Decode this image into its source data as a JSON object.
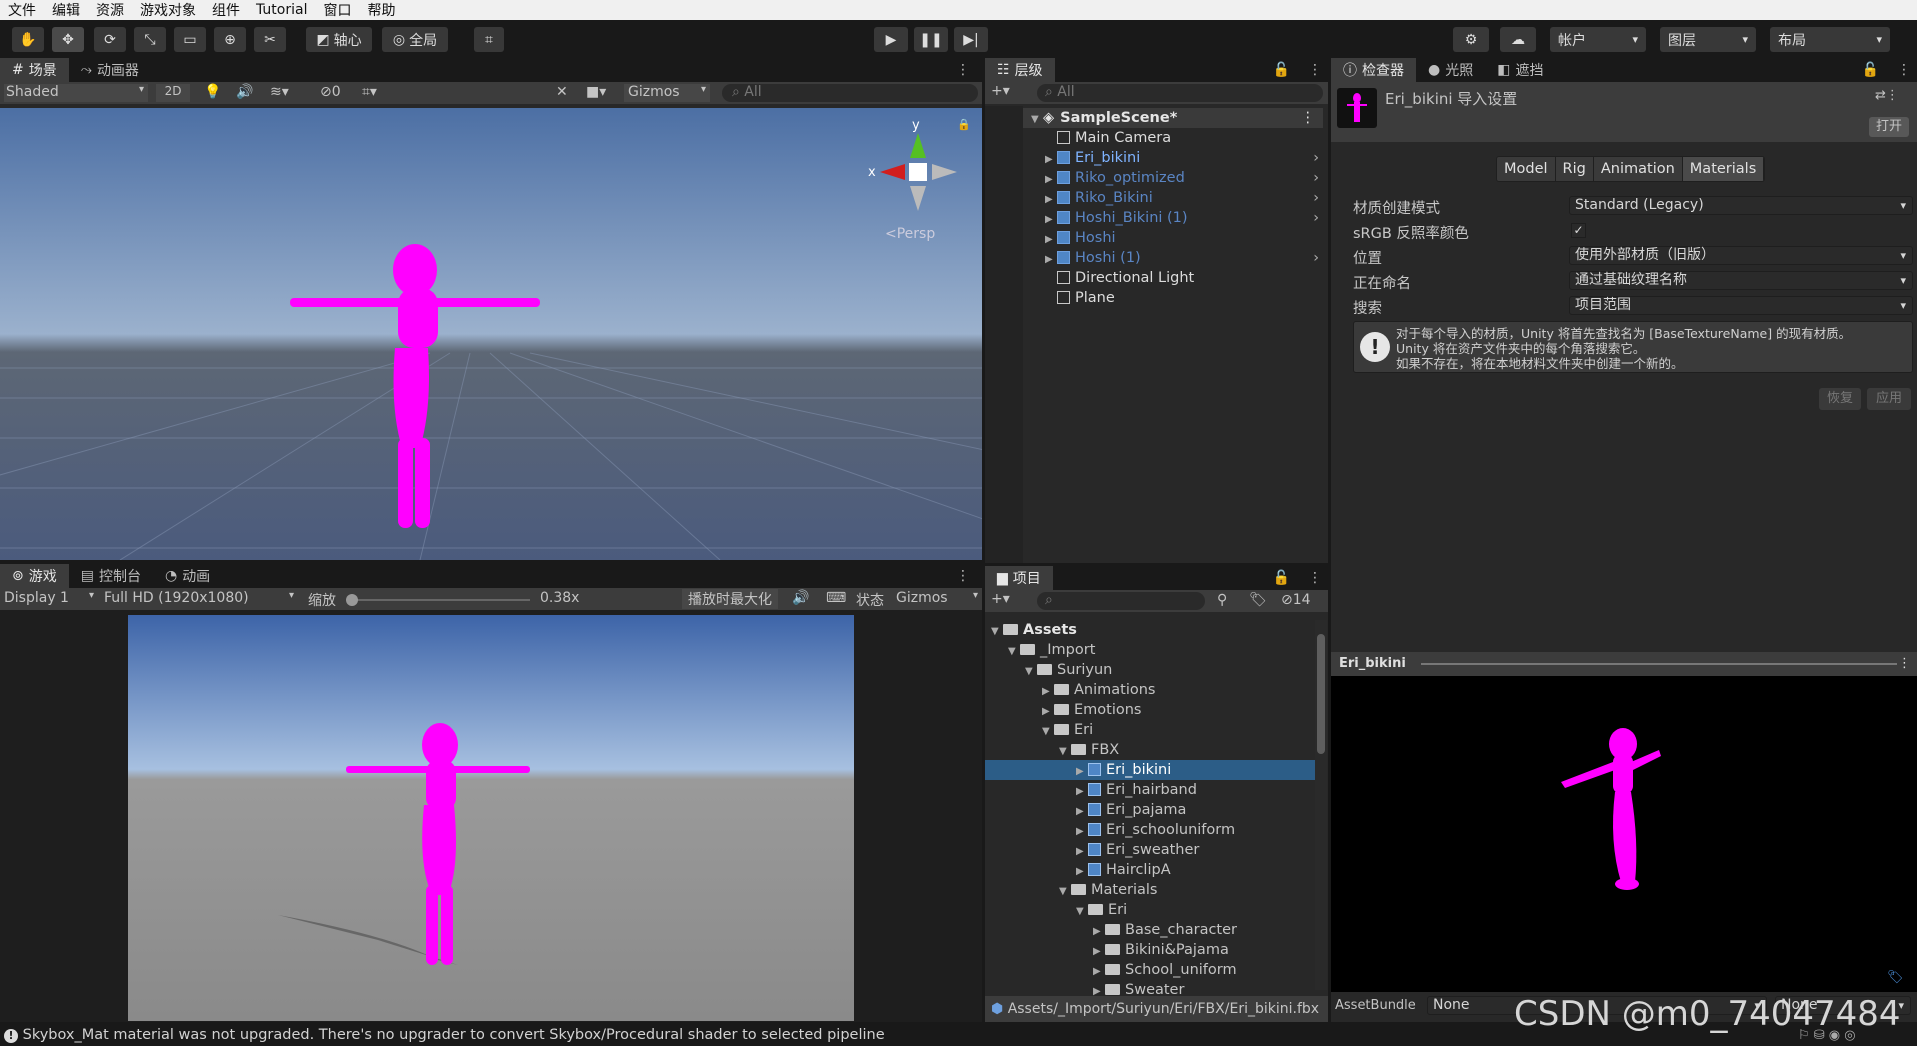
{
  "menu": [
    "文件",
    "编辑",
    "资源",
    "游戏对象",
    "组件",
    "Tutorial",
    "窗口",
    "帮助"
  ],
  "toolbar": {
    "pivot": "轴心",
    "global": "全局",
    "account": "帐户",
    "layers": "图层",
    "layout": "布局"
  },
  "scene": {
    "tab_scene": "场景",
    "tab_animator": "动画器",
    "shading": "Shaded",
    "mode2d": "2D",
    "hidden_count": "0",
    "gizmos": "Gizmos",
    "search_placeholder": "All",
    "persp": "<Persp",
    "axis_x": "x",
    "axis_y": "y"
  },
  "game": {
    "tab_game": "游戏",
    "tab_console": "控制台",
    "tab_animation": "动画",
    "display": "Display 1",
    "resolution": "Full HD (1920x1080)",
    "scale_label": "缩放",
    "scale_value": "0.38x",
    "maximize": "播放时最大化",
    "stats": "状态",
    "gizmos": "Gizmos",
    "scale_fraction": 0.0
  },
  "hierarchy": {
    "tab": "层级",
    "search_placeholder": "All",
    "scene": "SampleScene*",
    "items": [
      {
        "label": "Main Camera",
        "blue": false,
        "expand": false,
        "arrow_right": false
      },
      {
        "label": "Eri_bikini",
        "blue": true,
        "expand": true,
        "arrow_right": true,
        "bright": true
      },
      {
        "label": "Riko_optimized",
        "blue": true,
        "expand": true,
        "arrow_right": true
      },
      {
        "label": "Riko_Bikini",
        "blue": true,
        "expand": true,
        "arrow_right": true
      },
      {
        "label": "Hoshi_Bikini (1)",
        "blue": true,
        "expand": true,
        "arrow_right": true
      },
      {
        "label": "Hoshi",
        "blue": true,
        "expand": true,
        "arrow_right": false
      },
      {
        "label": "Hoshi (1)",
        "blue": true,
        "expand": true,
        "arrow_right": true
      },
      {
        "label": "Directional Light",
        "blue": false,
        "expand": false,
        "arrow_right": false
      },
      {
        "label": "Plane",
        "blue": false,
        "expand": false,
        "arrow_right": false
      }
    ]
  },
  "project": {
    "tab": "项目",
    "hidden_count": "14",
    "path": "Assets/_Import/Suriyun/Eri/FBX/Eri_bikini.fbx",
    "items": [
      {
        "label": "Assets",
        "depth": 0,
        "type": "folder",
        "open": true,
        "bold": true
      },
      {
        "label": "_Import",
        "depth": 1,
        "type": "folder",
        "open": true
      },
      {
        "label": "Suriyun",
        "depth": 2,
        "type": "folder",
        "open": true
      },
      {
        "label": "Animations",
        "depth": 3,
        "type": "folder",
        "open": false
      },
      {
        "label": "Emotions",
        "depth": 3,
        "type": "folder",
        "open": false
      },
      {
        "label": "Eri",
        "depth": 3,
        "type": "folder",
        "open": true
      },
      {
        "label": "FBX",
        "depth": 4,
        "type": "folder",
        "open": true
      },
      {
        "label": "Eri_bikini",
        "depth": 5,
        "type": "model",
        "open": false,
        "selected": true
      },
      {
        "label": "Eri_hairband",
        "depth": 5,
        "type": "model",
        "open": false
      },
      {
        "label": "Eri_pajama",
        "depth": 5,
        "type": "model",
        "open": false
      },
      {
        "label": "Eri_schooluniform",
        "depth": 5,
        "type": "model",
        "open": false
      },
      {
        "label": "Eri_sweather",
        "depth": 5,
        "type": "model",
        "open": false
      },
      {
        "label": "HairclipA",
        "depth": 5,
        "type": "model",
        "open": false
      },
      {
        "label": "Materials",
        "depth": 4,
        "type": "folder",
        "open": true
      },
      {
        "label": "Eri",
        "depth": 5,
        "type": "folder",
        "open": true
      },
      {
        "label": "Base_character",
        "depth": 6,
        "type": "folder",
        "open": false
      },
      {
        "label": "Bikini&Pajama",
        "depth": 6,
        "type": "folder",
        "open": false
      },
      {
        "label": "School_uniform",
        "depth": 6,
        "type": "folder",
        "open": false
      },
      {
        "label": "Sweater",
        "depth": 6,
        "type": "folder",
        "open": false
      }
    ]
  },
  "inspector": {
    "tab_inspector": "检查器",
    "tab_lighting": "光照",
    "tab_occlusion": "遮挡",
    "title": "Eri_bikini 导入设置",
    "open": "打开",
    "subtabs": [
      "Model",
      "Rig",
      "Animation",
      "Materials"
    ],
    "fields": [
      {
        "label": "材质创建模式",
        "value": "Standard (Legacy)",
        "type": "dropdown"
      },
      {
        "label": "sRGB 反照率颜色",
        "value": "✓",
        "type": "checkbox"
      },
      {
        "label": "位置",
        "value": "使用外部材质（旧版）",
        "type": "dropdown"
      },
      {
        "label": "正在命名",
        "value": "通过基础纹理名称",
        "type": "dropdown"
      },
      {
        "label": "搜索",
        "value": "项目范围",
        "type": "dropdown"
      }
    ],
    "info": [
      "对于每个导入的材质，Unity 将首先查找名为 [BaseTextureName] 的现有材质。",
      "Unity 将在资产文件夹中的每个角落搜索它。",
      "如果不存在，将在本地材料文件夹中创建一个新的。"
    ],
    "revert": "恢复",
    "apply": "应用"
  },
  "preview": {
    "title": "Eri_bikini",
    "assetbundle_label": "AssetBundle",
    "assetbundle_value": "None",
    "variant_value": "None"
  },
  "status": {
    "message": "Skybox_Mat material was not upgraded. There's no upgrader to convert Skybox/Procedural shader to selected pipeline"
  },
  "watermark": "CSDN @m0_74047484",
  "colors": {
    "accent_select": "#2c5d87",
    "magenta": "#ff00ff",
    "prefab_blue": "#6ea0df"
  }
}
